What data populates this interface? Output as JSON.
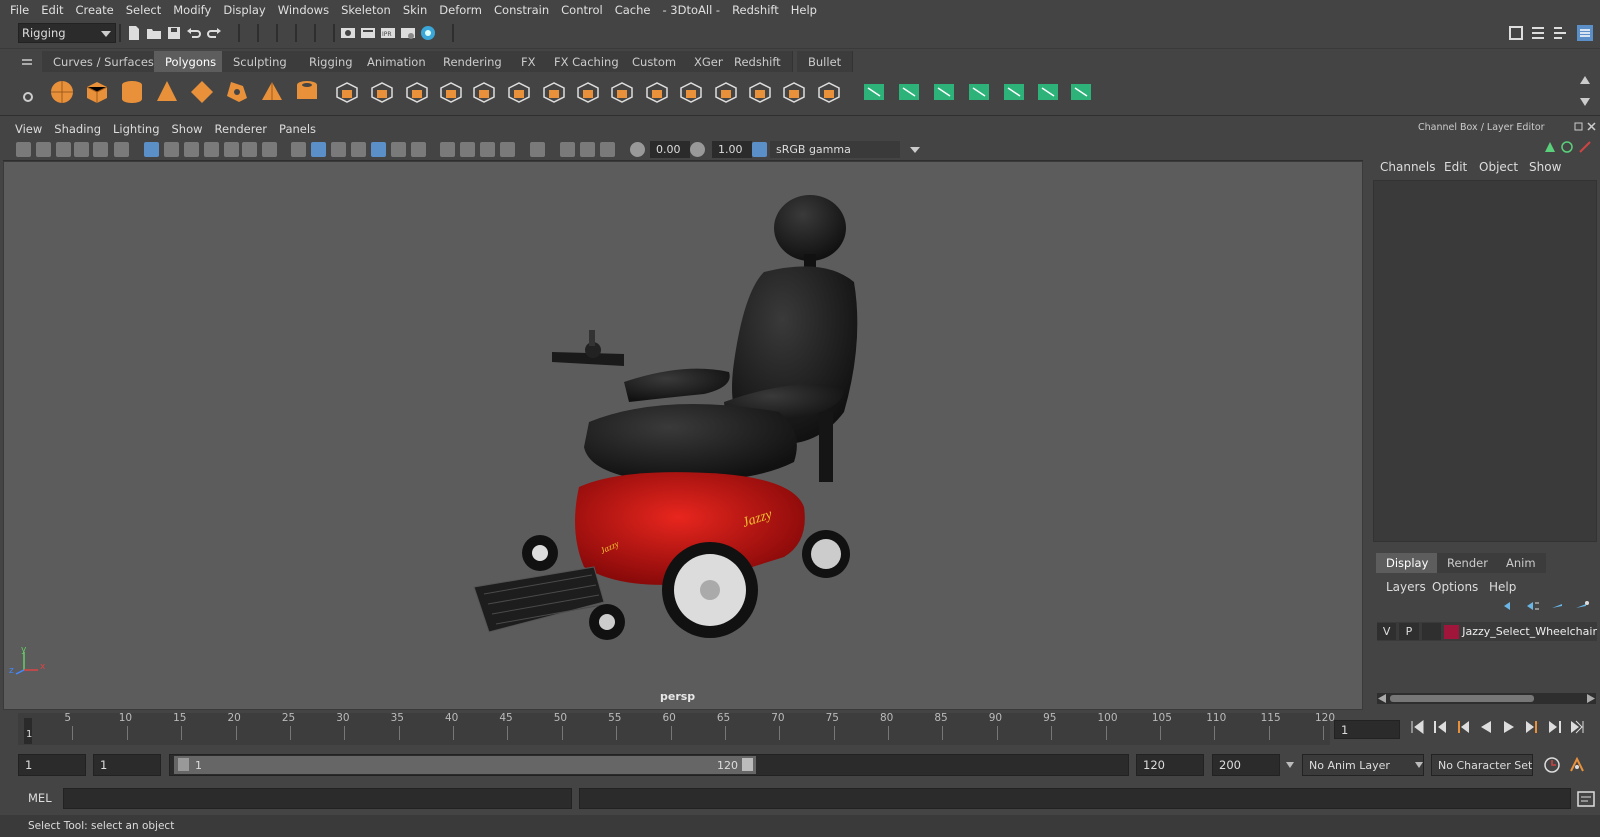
{
  "menubar": [
    "File",
    "Edit",
    "Create",
    "Select",
    "Modify",
    "Display",
    "Windows",
    "Skeleton",
    "Skin",
    "Deform",
    "Constrain",
    "Control",
    "Cache",
    "- 3DtoAll -",
    "Redshift",
    "Help"
  ],
  "mode_selector": {
    "value": "Rigging"
  },
  "shelf_tabs": [
    {
      "label": "Curves / Surfaces",
      "active": false
    },
    {
      "label": "Polygons",
      "active": true
    },
    {
      "label": "Sculpting",
      "active": false
    },
    {
      "label": "Rigging",
      "active": false
    },
    {
      "label": "Animation",
      "active": false
    },
    {
      "label": "Rendering",
      "active": false
    },
    {
      "label": "FX",
      "active": false
    },
    {
      "label": "FX Caching",
      "active": false
    },
    {
      "label": "Custom",
      "active": false
    },
    {
      "label": "XGen",
      "active": false
    },
    {
      "label": "Redshift",
      "active": false
    },
    {
      "label": "Bullet",
      "active": false
    }
  ],
  "shelf_icons": {
    "orange": [
      "poly-sphere-icon",
      "poly-cube-icon",
      "poly-cylinder-icon",
      "poly-cone-icon",
      "poly-plane-icon",
      "poly-torus-icon",
      "poly-pyramid-icon",
      "poly-pipe-icon"
    ],
    "tools": [
      "combine-icon",
      "separate-icon",
      "extract-icon",
      "smooth-icon",
      "bevel-icon",
      "bridge-icon",
      "extrude-icon",
      "multicut-icon",
      "target-weld-icon",
      "insert-edge-loop-icon",
      "merge-icon",
      "bevel-edge-icon",
      "mirror-icon",
      "center-pivot-icon",
      "freeze-transform-icon",
      "delete-history-icon"
    ],
    "green": [
      "uv-planar-icon",
      "uv-cylindrical-icon",
      "uv-spherical-icon",
      "uv-auto-icon",
      "uv-unfold-icon",
      "uv-editor-icon",
      "uv-layout-icon"
    ],
    "orange_color": "#e8913a",
    "green_color": "#2db37a"
  },
  "viewport": {
    "menu": [
      "View",
      "Shading",
      "Lighting",
      "Show",
      "Renderer",
      "Panels"
    ],
    "exposure": "0.00",
    "gamma": "1.00",
    "color_space": "sRGB gamma",
    "camera_label": "persp",
    "axis": {
      "y": "y",
      "x": "x",
      "z": "z"
    }
  },
  "channel_box": {
    "title": "Channel Box / Layer Editor",
    "menu": [
      "Channels",
      "Edit",
      "Object",
      "Show"
    ]
  },
  "layer_editor": {
    "tabs": [
      {
        "label": "Display",
        "active": true
      },
      {
        "label": "Render",
        "active": false
      },
      {
        "label": "Anim",
        "active": false
      }
    ],
    "menu": [
      "Layers",
      "Options",
      "Help"
    ],
    "layers": [
      {
        "v": "V",
        "p": "P",
        "name": "Jazzy_Select_Wheelchair",
        "color": "#a0163a"
      }
    ]
  },
  "timeline": {
    "ticks": [
      5,
      10,
      15,
      20,
      25,
      30,
      35,
      40,
      45,
      50,
      55,
      60,
      65,
      70,
      75,
      80,
      85,
      90,
      95,
      100,
      105,
      110,
      115,
      120
    ],
    "start_marker": "1",
    "current_frame": "1"
  },
  "range": {
    "start": "1",
    "playback_start": "1",
    "slider_start": "1",
    "slider_end": "120",
    "playback_end": "120",
    "end": "200",
    "anim_layer": "No Anim Layer",
    "character_set": "No Character Set"
  },
  "command_line": {
    "lang": "MEL"
  },
  "status": {
    "text": "Select Tool: select an object"
  }
}
